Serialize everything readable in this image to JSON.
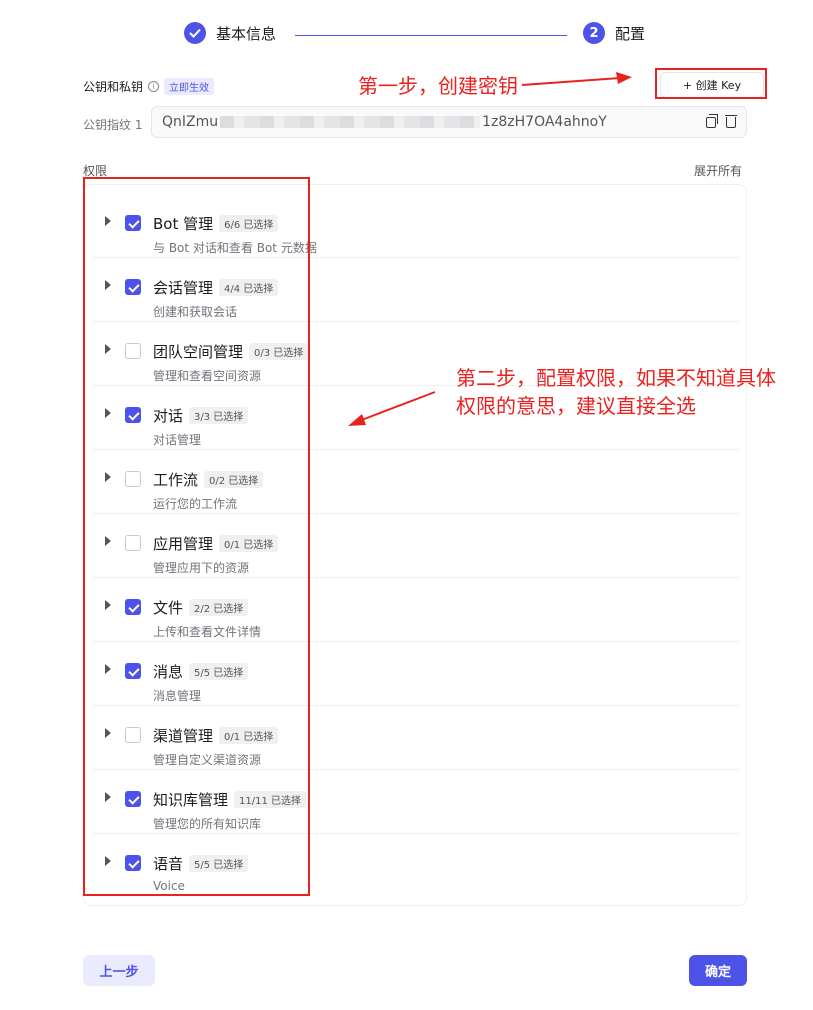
{
  "stepper": {
    "step1_label": "基本信息",
    "step2_number": "2",
    "step2_label": "配置"
  },
  "keys": {
    "label": "公钥和私钥",
    "info_icon": "i",
    "tag": "立即生效",
    "create_button": "+ 创建 Key",
    "fingerprint_label": "公钥指纹 1",
    "fingerprint_prefix": "QnIZmu",
    "fingerprint_suffix": "1z8zH7OA4ahnoY"
  },
  "annotations": {
    "step1": "第一步，创建密钥",
    "step2_line1": "第二步，配置权限，如果不知道具体",
    "step2_line2": "权限的意思，建议直接全选"
  },
  "permissions": {
    "header": "权限",
    "expand_all": "展开所有",
    "items": [
      {
        "title": "Bot 管理",
        "count": "6/6 已选择",
        "desc": "与 Bot 对话和查看 Bot 元数据",
        "checked": true
      },
      {
        "title": "会话管理",
        "count": "4/4 已选择",
        "desc": "创建和获取会话",
        "checked": true
      },
      {
        "title": "团队空间管理",
        "count": "0/3 已选择",
        "desc": "管理和查看空间资源",
        "checked": false
      },
      {
        "title": "对话",
        "count": "3/3 已选择",
        "desc": "对话管理",
        "checked": true
      },
      {
        "title": "工作流",
        "count": "0/2 已选择",
        "desc": "运行您的工作流",
        "checked": false
      },
      {
        "title": "应用管理",
        "count": "0/1 已选择",
        "desc": "管理应用下的资源",
        "checked": false
      },
      {
        "title": "文件",
        "count": "2/2 已选择",
        "desc": "上传和查看文件详情",
        "checked": true
      },
      {
        "title": "消息",
        "count": "5/5 已选择",
        "desc": "消息管理",
        "checked": true
      },
      {
        "title": "渠道管理",
        "count": "0/1 已选择",
        "desc": "管理自定义渠道资源",
        "checked": false
      },
      {
        "title": "知识库管理",
        "count": "11/11 已选择",
        "desc": "管理您的所有知识库",
        "checked": true
      },
      {
        "title": "语音",
        "count": "5/5 已选择",
        "desc": "Voice",
        "checked": true
      }
    ]
  },
  "footer": {
    "prev_button": "上一步",
    "ok_button": "确定"
  },
  "colors": {
    "accent": "#4d53e8",
    "annotation_red": "#e8231f"
  }
}
